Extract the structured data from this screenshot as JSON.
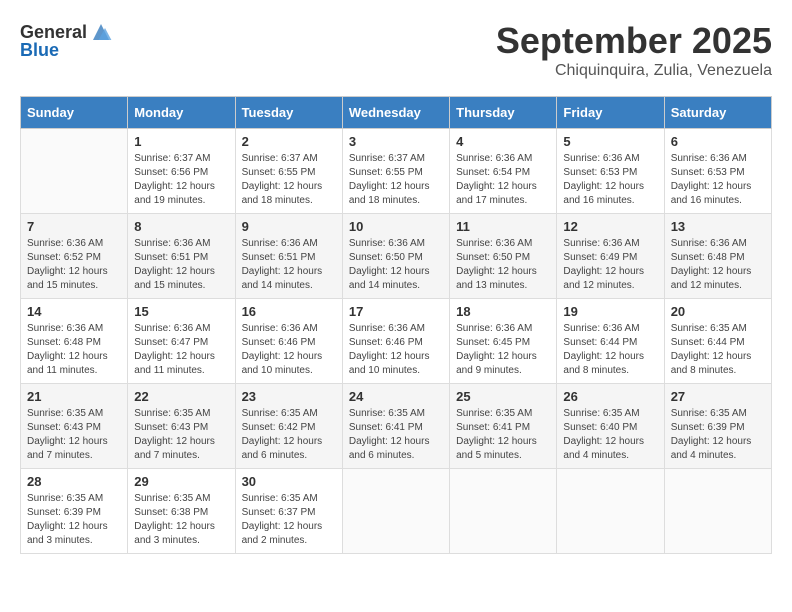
{
  "header": {
    "logo_general": "General",
    "logo_blue": "Blue",
    "month_title": "September 2025",
    "location": "Chiquinquira, Zulia, Venezuela"
  },
  "calendar": {
    "days_of_week": [
      "Sunday",
      "Monday",
      "Tuesday",
      "Wednesday",
      "Thursday",
      "Friday",
      "Saturday"
    ],
    "weeks": [
      [
        {
          "day": "",
          "info": ""
        },
        {
          "day": "1",
          "info": "Sunrise: 6:37 AM\nSunset: 6:56 PM\nDaylight: 12 hours\nand 19 minutes."
        },
        {
          "day": "2",
          "info": "Sunrise: 6:37 AM\nSunset: 6:55 PM\nDaylight: 12 hours\nand 18 minutes."
        },
        {
          "day": "3",
          "info": "Sunrise: 6:37 AM\nSunset: 6:55 PM\nDaylight: 12 hours\nand 18 minutes."
        },
        {
          "day": "4",
          "info": "Sunrise: 6:36 AM\nSunset: 6:54 PM\nDaylight: 12 hours\nand 17 minutes."
        },
        {
          "day": "5",
          "info": "Sunrise: 6:36 AM\nSunset: 6:53 PM\nDaylight: 12 hours\nand 16 minutes."
        },
        {
          "day": "6",
          "info": "Sunrise: 6:36 AM\nSunset: 6:53 PM\nDaylight: 12 hours\nand 16 minutes."
        }
      ],
      [
        {
          "day": "7",
          "info": "Sunrise: 6:36 AM\nSunset: 6:52 PM\nDaylight: 12 hours\nand 15 minutes."
        },
        {
          "day": "8",
          "info": "Sunrise: 6:36 AM\nSunset: 6:51 PM\nDaylight: 12 hours\nand 15 minutes."
        },
        {
          "day": "9",
          "info": "Sunrise: 6:36 AM\nSunset: 6:51 PM\nDaylight: 12 hours\nand 14 minutes."
        },
        {
          "day": "10",
          "info": "Sunrise: 6:36 AM\nSunset: 6:50 PM\nDaylight: 12 hours\nand 14 minutes."
        },
        {
          "day": "11",
          "info": "Sunrise: 6:36 AM\nSunset: 6:50 PM\nDaylight: 12 hours\nand 13 minutes."
        },
        {
          "day": "12",
          "info": "Sunrise: 6:36 AM\nSunset: 6:49 PM\nDaylight: 12 hours\nand 12 minutes."
        },
        {
          "day": "13",
          "info": "Sunrise: 6:36 AM\nSunset: 6:48 PM\nDaylight: 12 hours\nand 12 minutes."
        }
      ],
      [
        {
          "day": "14",
          "info": "Sunrise: 6:36 AM\nSunset: 6:48 PM\nDaylight: 12 hours\nand 11 minutes."
        },
        {
          "day": "15",
          "info": "Sunrise: 6:36 AM\nSunset: 6:47 PM\nDaylight: 12 hours\nand 11 minutes."
        },
        {
          "day": "16",
          "info": "Sunrise: 6:36 AM\nSunset: 6:46 PM\nDaylight: 12 hours\nand 10 minutes."
        },
        {
          "day": "17",
          "info": "Sunrise: 6:36 AM\nSunset: 6:46 PM\nDaylight: 12 hours\nand 10 minutes."
        },
        {
          "day": "18",
          "info": "Sunrise: 6:36 AM\nSunset: 6:45 PM\nDaylight: 12 hours\nand 9 minutes."
        },
        {
          "day": "19",
          "info": "Sunrise: 6:36 AM\nSunset: 6:44 PM\nDaylight: 12 hours\nand 8 minutes."
        },
        {
          "day": "20",
          "info": "Sunrise: 6:35 AM\nSunset: 6:44 PM\nDaylight: 12 hours\nand 8 minutes."
        }
      ],
      [
        {
          "day": "21",
          "info": "Sunrise: 6:35 AM\nSunset: 6:43 PM\nDaylight: 12 hours\nand 7 minutes."
        },
        {
          "day": "22",
          "info": "Sunrise: 6:35 AM\nSunset: 6:43 PM\nDaylight: 12 hours\nand 7 minutes."
        },
        {
          "day": "23",
          "info": "Sunrise: 6:35 AM\nSunset: 6:42 PM\nDaylight: 12 hours\nand 6 minutes."
        },
        {
          "day": "24",
          "info": "Sunrise: 6:35 AM\nSunset: 6:41 PM\nDaylight: 12 hours\nand 6 minutes."
        },
        {
          "day": "25",
          "info": "Sunrise: 6:35 AM\nSunset: 6:41 PM\nDaylight: 12 hours\nand 5 minutes."
        },
        {
          "day": "26",
          "info": "Sunrise: 6:35 AM\nSunset: 6:40 PM\nDaylight: 12 hours\nand 4 minutes."
        },
        {
          "day": "27",
          "info": "Sunrise: 6:35 AM\nSunset: 6:39 PM\nDaylight: 12 hours\nand 4 minutes."
        }
      ],
      [
        {
          "day": "28",
          "info": "Sunrise: 6:35 AM\nSunset: 6:39 PM\nDaylight: 12 hours\nand 3 minutes."
        },
        {
          "day": "29",
          "info": "Sunrise: 6:35 AM\nSunset: 6:38 PM\nDaylight: 12 hours\nand 3 minutes."
        },
        {
          "day": "30",
          "info": "Sunrise: 6:35 AM\nSunset: 6:37 PM\nDaylight: 12 hours\nand 2 minutes."
        },
        {
          "day": "",
          "info": ""
        },
        {
          "day": "",
          "info": ""
        },
        {
          "day": "",
          "info": ""
        },
        {
          "day": "",
          "info": ""
        }
      ]
    ]
  }
}
